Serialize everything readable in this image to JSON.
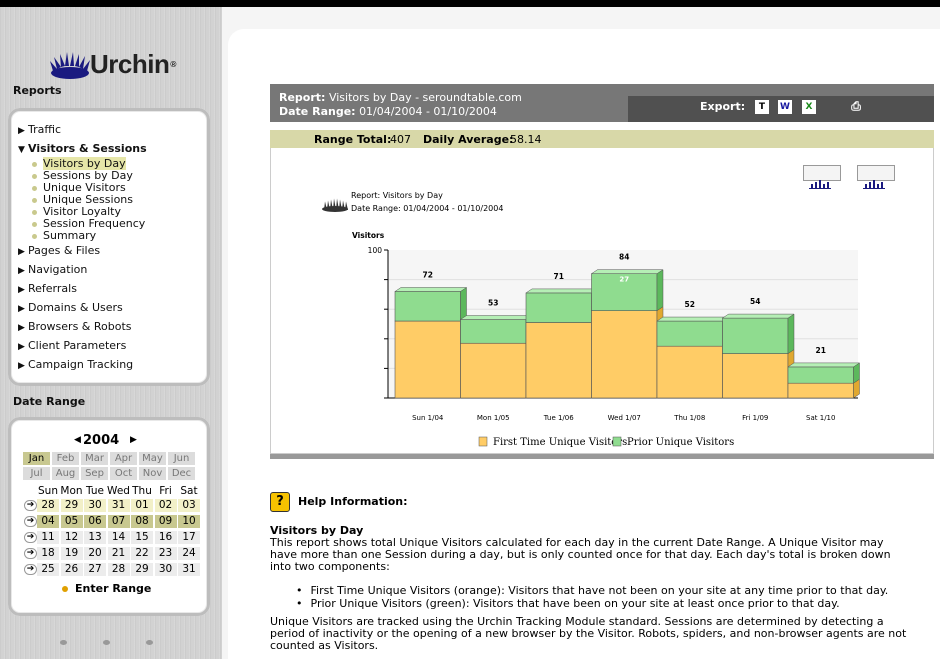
{
  "brand": {
    "name": "Urchin",
    "reg": "®"
  },
  "sidebar": {
    "reports_heading": "Reports",
    "date_heading": "Date Range",
    "nav": [
      {
        "label": "Traffic",
        "expanded": false
      },
      {
        "label": "Visitors & Sessions",
        "expanded": true
      },
      {
        "label": "Pages & Files",
        "expanded": false
      },
      {
        "label": "Navigation",
        "expanded": false
      },
      {
        "label": "Referrals",
        "expanded": false
      },
      {
        "label": "Domains & Users",
        "expanded": false
      },
      {
        "label": "Browsers & Robots",
        "expanded": false
      },
      {
        "label": "Client Parameters",
        "expanded": false
      },
      {
        "label": "Campaign Tracking",
        "expanded": false
      }
    ],
    "sub": [
      "Visitors by Day",
      "Sessions by Day",
      "Unique Visitors",
      "Unique Sessions",
      "Visitor Loyalty",
      "Session Frequency",
      "Summary"
    ],
    "selected_sub": "Visitors by Day"
  },
  "calendar": {
    "year": "2004",
    "months": [
      "Jan",
      "Feb",
      "Mar",
      "Apr",
      "May",
      "Jun",
      "Jul",
      "Aug",
      "Sep",
      "Oct",
      "Nov",
      "Dec"
    ],
    "selected_month": "Jan",
    "dow": [
      "Sun",
      "Mon",
      "Tue",
      "Wed",
      "Thu",
      "Fri",
      "Sat"
    ],
    "weeks": [
      [
        "28",
        "29",
        "30",
        "31",
        "01",
        "02",
        "03"
      ],
      [
        "04",
        "05",
        "06",
        "07",
        "08",
        "09",
        "10"
      ],
      [
        "11",
        "12",
        "13",
        "14",
        "15",
        "16",
        "17"
      ],
      [
        "18",
        "19",
        "20",
        "21",
        "22",
        "23",
        "24"
      ],
      [
        "25",
        "26",
        "27",
        "28",
        "29",
        "30",
        "31"
      ]
    ],
    "selected_week": 1,
    "enter_label": "Enter Range"
  },
  "report": {
    "report_label": "Report:",
    "report_value": "Visitors by Day - seroundtable.com",
    "range_label": "Date Range:",
    "range_value": "01/04/2004 - 01/10/2004",
    "export_label": "Export:",
    "export_icons": [
      "T",
      "W",
      "X"
    ],
    "range_total_label": "Range Total:",
    "range_total": "407",
    "daily_avg_label": "Daily Average:",
    "daily_avg": "58.14"
  },
  "chart_data": {
    "type": "bar",
    "stacked": true,
    "title": "Report: Visitors by Day",
    "subtitle": "Date Range: 01/04/2004 - 01/10/2004",
    "ylabel": "Visitors",
    "ylim": [
      0,
      100
    ],
    "y_tick_label": "100",
    "categories": [
      "Sun 1/04",
      "Mon 1/05",
      "Tue 1/06",
      "Wed 1/07",
      "Thu 1/08",
      "Fri 1/09",
      "Sat 1/10"
    ],
    "totals": [
      72,
      53,
      71,
      84,
      52,
      54,
      21
    ],
    "series": [
      {
        "name": "First Time Unique Visitors",
        "color": "#ffcc66",
        "values": [
          52,
          37,
          51,
          59,
          35,
          30,
          10
        ]
      },
      {
        "name": "Prior Unique Visitors",
        "color": "#8fdc8f",
        "values": [
          20,
          16,
          20,
          25,
          17,
          24,
          11
        ]
      }
    ],
    "inner_labels": [
      "",
      "",
      "",
      "27",
      "",
      "",
      ""
    ],
    "legend_position": "bottom"
  },
  "help": {
    "title": "Help Information:",
    "section": "Visitors by Day",
    "p1": "This report shows total Unique Visitors calculated for each day in the current Date Range. A Unique Visitor may have more than one Session during a day, but is only counted once for that day. Each day's total is broken down into two components:",
    "bullets": [
      "First Time Unique Visitors (orange): Visitors that have not been on your site at any time prior to that day.",
      "Prior Unique Visitors (green): Visitors that have been on your site at least once prior to that day."
    ],
    "p2": "Unique Visitors are tracked using the Urchin Tracking Module standard. Sessions are determined by detecting a period of inactivity or the opening of a new browser by the Visitor. Robots, spiders, and non-browser agents are not counted as Visitors."
  }
}
